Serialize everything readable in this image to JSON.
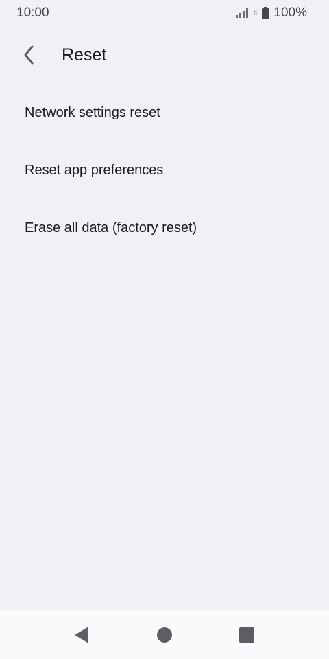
{
  "status_bar": {
    "time": "10:00",
    "battery": "100%",
    "icons": [
      "signal-icon",
      "data-icon",
      "battery-icon"
    ]
  },
  "app_bar": {
    "title": "Reset",
    "back_icon": "chevron-left-icon"
  },
  "settings": {
    "items": [
      {
        "label": "Network settings reset"
      },
      {
        "label": "Reset app preferences"
      },
      {
        "label": "Erase all data (factory reset)"
      }
    ]
  },
  "nav_bar": {
    "icons": [
      "back-triangle-icon",
      "home-circle-icon",
      "recents-square-icon"
    ]
  },
  "colors": {
    "background": "#f2f0f4",
    "text": "#1c1b1f",
    "icon": "#5f5c64",
    "nav_background": "#faf9fb"
  }
}
